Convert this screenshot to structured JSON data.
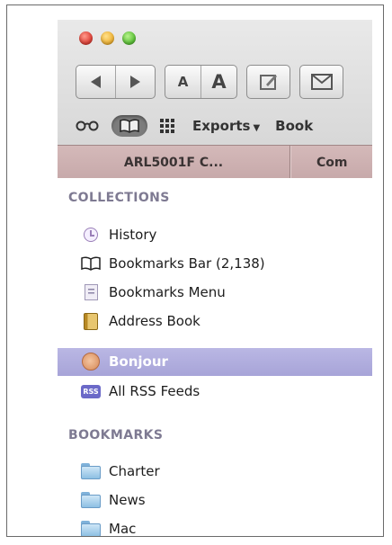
{
  "toolbar": {
    "font_smaller_label": "A",
    "font_larger_label": "A",
    "exports_label": "Exports",
    "exports_caret": "▼",
    "bookmarks_label": "Book"
  },
  "tabs": [
    {
      "label": "ARL5001F C..."
    },
    {
      "label": "Com"
    }
  ],
  "sidebar": {
    "collections_header": "COLLECTIONS",
    "collections": [
      {
        "label": "History",
        "icon": "history-clock-icon"
      },
      {
        "label": "Bookmarks Bar (2,138)",
        "icon": "open-book-icon"
      },
      {
        "label": "Bookmarks Menu",
        "icon": "bookmarks-menu-icon"
      },
      {
        "label": "Address Book",
        "icon": "address-book-icon"
      },
      {
        "label": "Bonjour",
        "icon": "bonjour-icon",
        "selected": true
      },
      {
        "label": "All RSS Feeds",
        "icon": "rss-icon"
      }
    ],
    "bookmarks_header": "BOOKMARKS",
    "bookmarks": [
      {
        "label": "Charter",
        "icon": "folder-icon"
      },
      {
        "label": "News",
        "icon": "folder-icon"
      },
      {
        "label": "Mac",
        "icon": "folder-icon"
      }
    ],
    "rss_badge": "RSS"
  },
  "colors": {
    "selection": "#aba8dc",
    "section_header": "#7e7a92",
    "tab_bar": "#cdb0b0"
  }
}
